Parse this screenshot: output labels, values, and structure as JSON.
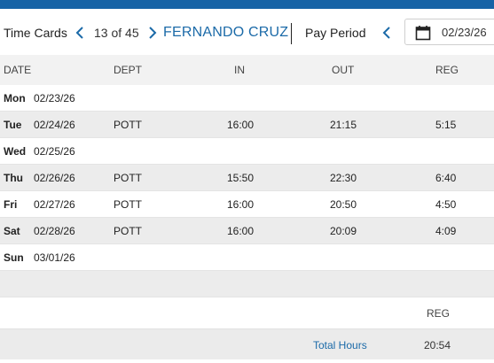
{
  "header": {
    "title": "Time Cards",
    "counter": "13 of 45",
    "employee": "FERNANDO CRUZ",
    "pay_period_label": "Pay Period",
    "date_value": "02/23/26"
  },
  "columns": {
    "date": "DATE",
    "dept": "DEPT",
    "in": "IN",
    "out": "OUT",
    "reg": "REG"
  },
  "rows": [
    {
      "day": "Mon",
      "date": "02/23/26",
      "dept": "",
      "in": "",
      "out": "",
      "reg": ""
    },
    {
      "day": "Tue",
      "date": "02/24/26",
      "dept": "POTT",
      "in": "16:00",
      "out": "21:15",
      "reg": "5:15"
    },
    {
      "day": "Wed",
      "date": "02/25/26",
      "dept": "",
      "in": "",
      "out": "",
      "reg": ""
    },
    {
      "day": "Thu",
      "date": "02/26/26",
      "dept": "POTT",
      "in": "15:50",
      "out": "22:30",
      "reg": "6:40"
    },
    {
      "day": "Fri",
      "date": "02/27/26",
      "dept": "POTT",
      "in": "16:00",
      "out": "20:50",
      "reg": "4:50"
    },
    {
      "day": "Sat",
      "date": "02/28/26",
      "dept": "POTT",
      "in": "16:00",
      "out": "20:09",
      "reg": "4:09"
    },
    {
      "day": "Sun",
      "date": "03/01/26",
      "dept": "",
      "in": "",
      "out": "",
      "reg": ""
    }
  ],
  "summary": {
    "reg_header": "REG",
    "total_label": "Total Hours",
    "total_value": "20:54"
  },
  "colors": {
    "accent": "#1b6aa8",
    "topbar": "#1763a6"
  },
  "icons": {
    "prev": "chevron-left-icon",
    "next": "chevron-right-icon",
    "calendar": "calendar-icon"
  }
}
